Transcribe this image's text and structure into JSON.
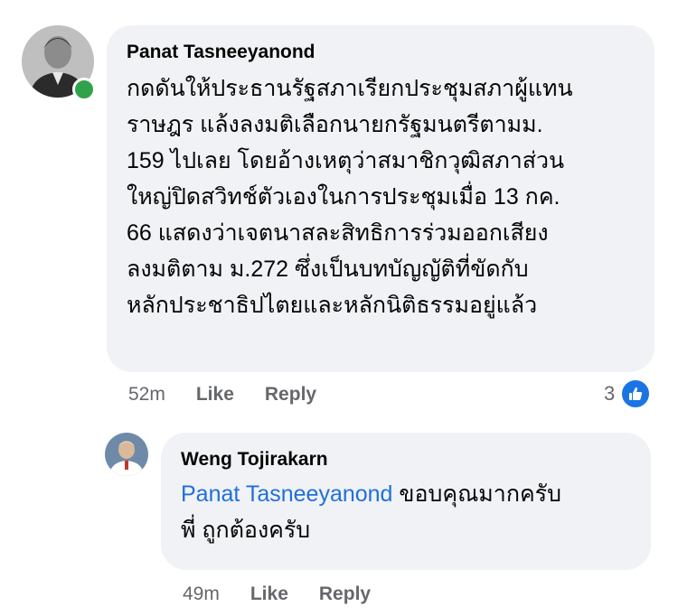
{
  "comment": {
    "author": "Panat Tasneeyanond",
    "avatar_icon": "profile-photo-icon",
    "online": true,
    "text_lines": [
      "กดดันให้ประธานรัฐสภาเรียกประชุมสภาผู้แทน",
      "ราษฎร แล้งลงมติเลือกนายกรัฐมนตรีตามม.",
      "159 ไปเลย โดยอ้างเหตุว่าสมาชิกวุฒิสภาส่วน",
      "ใหญ่ปิดสวิทช์ตัวเองในการประชุมเมื่อ 13 กค.",
      "66 แสดงว่าเจตนาสละสิทธิการร่วมออกเสียง",
      "ลงมติตาม ม.272 ซึ่งเป็นบทบัญญัติที่ขัดกับ",
      "หลักประชาธิปไตยและหลักนิติธรรมอยู่แล้ว"
    ],
    "time": "52m",
    "like_label": "Like",
    "reply_label": "Reply",
    "reaction_count": "3",
    "reaction_icon": "thumbs-up-icon"
  },
  "reply": {
    "author": "Weng Tojirakarn",
    "avatar_icon": "profile-photo-icon",
    "mention": "Panat Tasneeyanond",
    "text_after_mention": " ขอบคุณมากครับ",
    "text_line2": "พี่ ถูกต้องครับ",
    "time": "49m",
    "like_label": "Like",
    "reply_label": "Reply"
  },
  "colors": {
    "bubble_bg": "#f0f2f5",
    "mention": "#216fdb",
    "meta_text": "#65676b",
    "like_blue": "#1b74e4",
    "online_green": "#31a24c"
  }
}
